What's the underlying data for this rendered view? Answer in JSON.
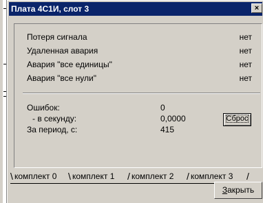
{
  "window": {
    "title": "Плата 4С1И, слот 3",
    "close_glyph": "×"
  },
  "alarms": [
    {
      "label": "Потеря сигнала",
      "value": "нет"
    },
    {
      "label": "Удаленная авария",
      "value": "нет"
    },
    {
      "label": "Авария \"все единицы\"",
      "value": "нет"
    },
    {
      "label": "Авария \"все нули\"",
      "value": "нет"
    }
  ],
  "stats": {
    "errors_label": "Ошибок:",
    "errors_value": "0",
    "per_sec_label": "- в секунду:",
    "per_sec_value": "0,0000",
    "period_label": "За период, с:",
    "period_value": "415"
  },
  "buttons": {
    "reset_label": "Сброс",
    "close_mnemonic": "З",
    "close_rest": "акрыть"
  },
  "tabs": [
    {
      "label": "комплект 0"
    },
    {
      "label": "комплект 1"
    },
    {
      "label": "комплект 2"
    },
    {
      "label": "комплект 3"
    }
  ]
}
